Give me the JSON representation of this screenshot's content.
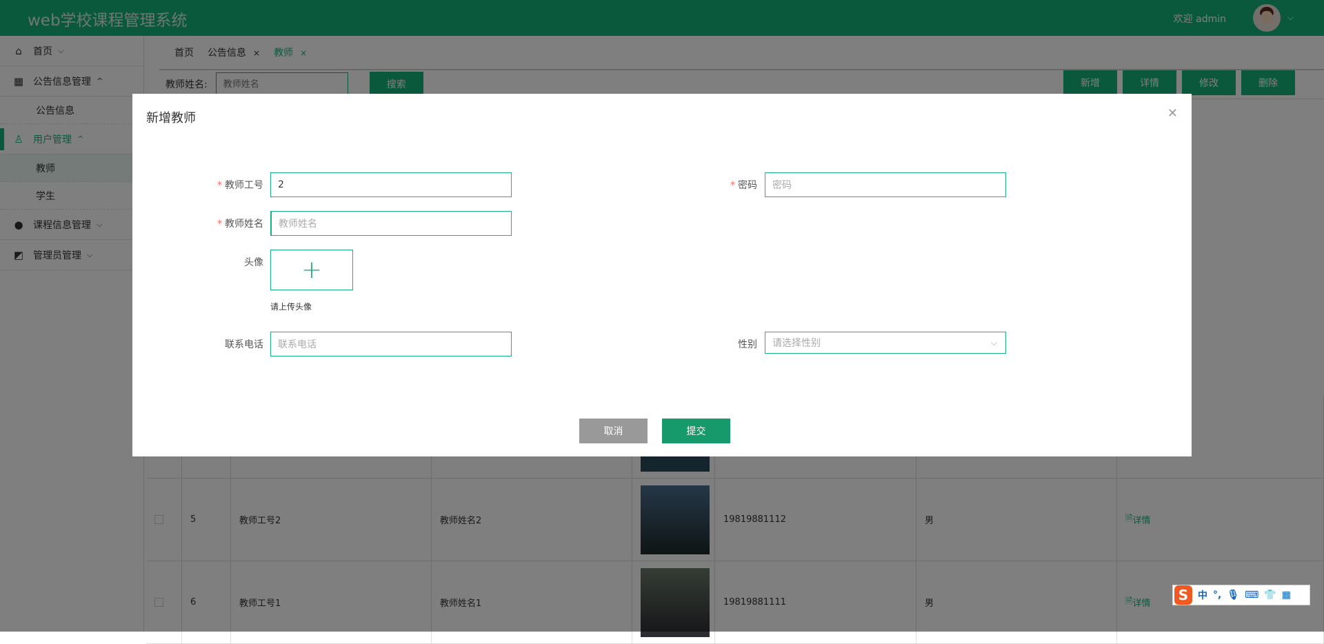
{
  "header": {
    "title": "web学校课程管理系统",
    "welcome": "欢迎 admin"
  },
  "sidebar": {
    "items": [
      {
        "label": "首页"
      },
      {
        "label": "公告信息管理",
        "children": [
          "公告信息"
        ]
      },
      {
        "label": "用户管理",
        "children": [
          "教师",
          "学生"
        ]
      },
      {
        "label": "课程信息管理"
      },
      {
        "label": "管理员管理"
      }
    ]
  },
  "tabs": [
    {
      "label": "首页"
    },
    {
      "label": "公告信息",
      "close": "×"
    },
    {
      "label": "教师",
      "close": "×"
    }
  ],
  "search": {
    "label": "教师姓名:",
    "placeholder": "教师姓名",
    "button": "搜索"
  },
  "actions": {
    "add": "新增",
    "detail": "详情",
    "edit": "修改",
    "delete": "删除"
  },
  "table": {
    "rows": [
      {
        "index": "5",
        "teacher_id": "教师工号2",
        "name": "教师姓名2",
        "phone": "19819881112",
        "gender": "男",
        "action": "详情"
      },
      {
        "index": "6",
        "teacher_id": "教师工号1",
        "name": "教师姓名1",
        "phone": "19819881111",
        "gender": "男",
        "action": "详情"
      }
    ]
  },
  "dialog": {
    "title": "新增教师",
    "fields": {
      "teacher_id": {
        "label": "教师工号",
        "value": "2"
      },
      "password": {
        "label": "密码",
        "placeholder": "密码"
      },
      "name": {
        "label": "教师姓名",
        "placeholder": "教师姓名"
      },
      "avatar": {
        "label": "头像",
        "hint": "请上传头像"
      },
      "phone": {
        "label": "联系电话",
        "placeholder": "联系电话"
      },
      "gender": {
        "label": "性别",
        "placeholder": "请选择性别"
      }
    },
    "cancel": "取消",
    "submit": "提交"
  },
  "ime": {
    "mode": "中"
  },
  "colors": {
    "primary": "#16b37b",
    "cancel": "#999999"
  }
}
